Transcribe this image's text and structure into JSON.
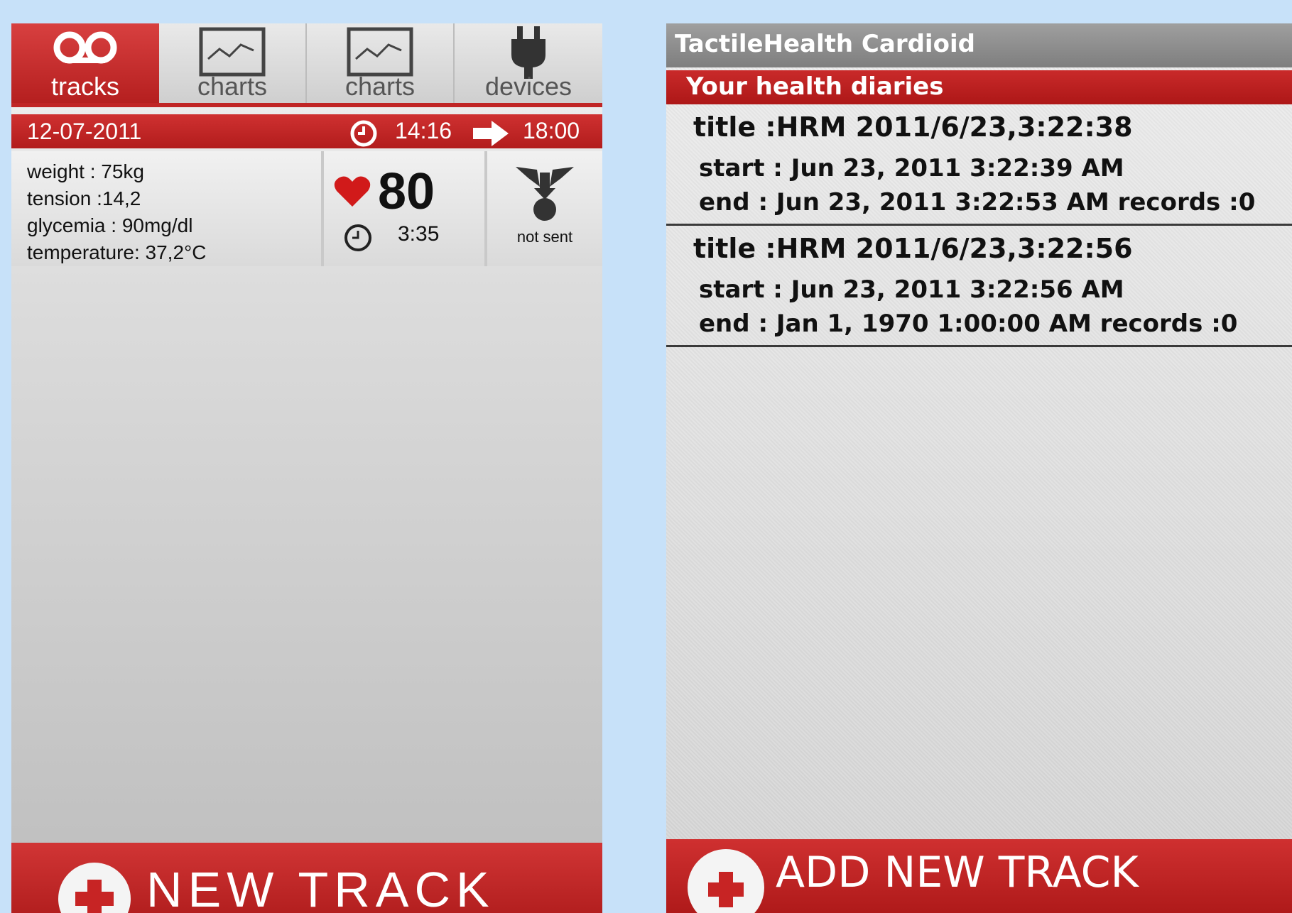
{
  "left": {
    "tabs": [
      {
        "label": "tracks",
        "icon": "tracks-icon",
        "active": true
      },
      {
        "label": "charts",
        "icon": "chart-icon",
        "active": false
      },
      {
        "label": "charts",
        "icon": "chart-icon",
        "active": false
      },
      {
        "label": "devices",
        "icon": "plug-icon",
        "active": false
      }
    ],
    "date": "12-07-2011",
    "time_start": "14:16",
    "time_end": "18:00",
    "metrics": {
      "weight": "weight : 75kg",
      "tension": "tension :14,2",
      "glycemia": "glycemia : 90mg/dl",
      "temperature": "temperature: 37,2°C"
    },
    "heart_rate": "80",
    "duration": "3:35",
    "status": "not sent",
    "new_track_label": "NEW TRACK",
    "colors": {
      "accent": "#c02525"
    }
  },
  "right": {
    "app_title": "TactileHealth Cardioid",
    "section_title": "Your health diaries",
    "diaries": [
      {
        "title": "title :HRM 2011/6/23,3:22:38",
        "start": "start : Jun 23, 2011 3:22:39 AM",
        "end": "end : Jun 23, 2011 3:22:53 AM records :0"
      },
      {
        "title": "title :HRM 2011/6/23,3:22:56",
        "start": "start : Jun 23, 2011 3:22:56 AM",
        "end": "end : Jan 1, 1970 1:00:00 AM records :0"
      }
    ],
    "add_track_label": "ADD NEW TRACK"
  }
}
